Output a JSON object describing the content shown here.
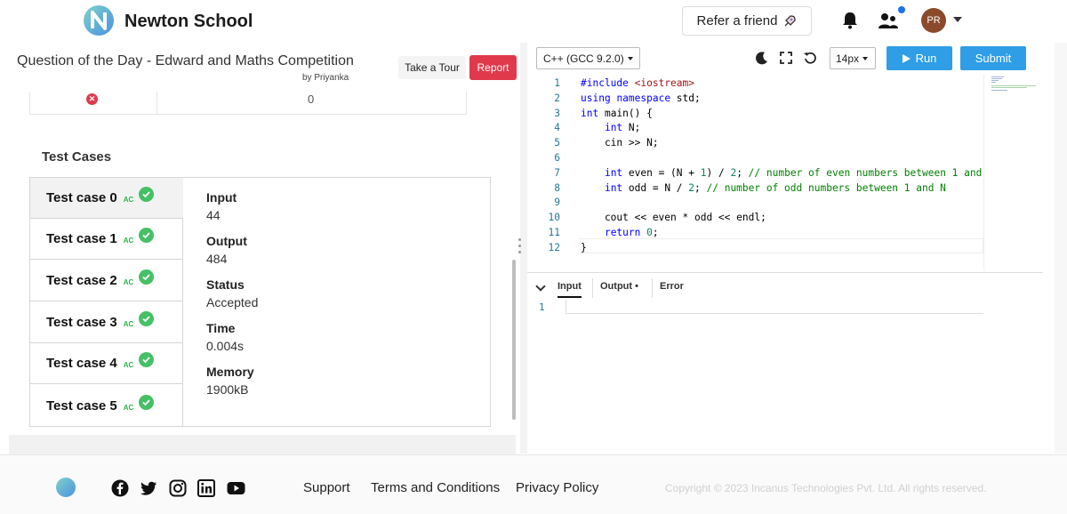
{
  "header": {
    "brand": "Newton School",
    "refer_label": "Refer a friend",
    "avatar_initials": "PR"
  },
  "question": {
    "title": "Question of the Day - Edward and Maths Competition",
    "author": "by Priyanka",
    "tour_label": "Take a Tour",
    "report_label": "Report",
    "prev_value": "0"
  },
  "test_cases": {
    "heading": "Test Cases",
    "items": [
      {
        "label": "Test case 0",
        "status": "AC"
      },
      {
        "label": "Test case 1",
        "status": "AC"
      },
      {
        "label": "Test case 2",
        "status": "AC"
      },
      {
        "label": "Test case 3",
        "status": "AC"
      },
      {
        "label": "Test case 4",
        "status": "AC"
      },
      {
        "label": "Test case 5",
        "status": "AC"
      }
    ],
    "detail": {
      "input_label": "Input",
      "input_value": "44",
      "output_label": "Output",
      "output_value": "484",
      "status_label": "Status",
      "status_value": "Accepted",
      "time_label": "Time",
      "time_value": "0.004s",
      "memory_label": "Memory",
      "memory_value": "1900kB"
    }
  },
  "editor": {
    "language": "C++ (GCC 9.2.0)",
    "font_size": "14px",
    "run_label": "Run",
    "submit_label": "Submit",
    "lines": [
      {
        "n": "1",
        "code": "#include <iostream>"
      },
      {
        "n": "2",
        "code": "using namespace std;"
      },
      {
        "n": "3",
        "code": "int main() {"
      },
      {
        "n": "4",
        "code": "    int N;"
      },
      {
        "n": "5",
        "code": "    cin >> N;"
      },
      {
        "n": "6",
        "code": ""
      },
      {
        "n": "7",
        "code": "    int even = (N + 1) / 2; // number of even numbers between 1 and"
      },
      {
        "n": "8",
        "code": "    int odd = N / 2; // number of odd numbers between 1 and N"
      },
      {
        "n": "9",
        "code": ""
      },
      {
        "n": "10",
        "code": "    cout << even * odd << endl;"
      },
      {
        "n": "11",
        "code": "    return 0;"
      },
      {
        "n": "12",
        "code": "}"
      }
    ]
  },
  "io": {
    "input_tab": "Input",
    "output_tab": "Output",
    "output_marker": "•",
    "error_tab": "Error",
    "line_number": "1"
  },
  "footer": {
    "support": "Support",
    "terms": "Terms and Conditions",
    "privacy": "Privacy Policy",
    "copyright": "Copyright © 2023 Incanus Technologies Pvt. Ltd. All rights reserved."
  },
  "colors": {
    "accent": "#2f9ee6",
    "report": "#e0394b",
    "success": "#46c066"
  }
}
